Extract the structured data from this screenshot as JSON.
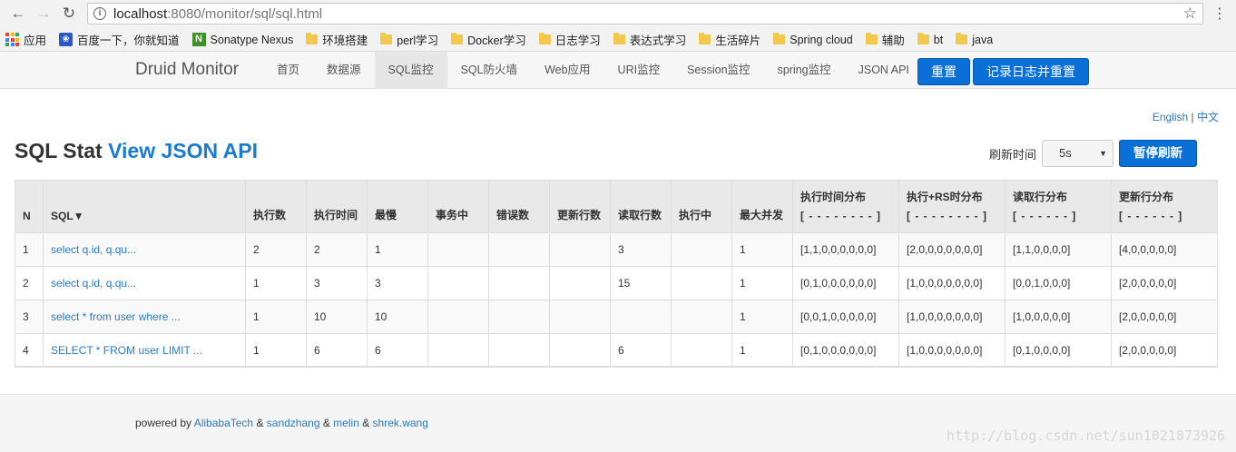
{
  "browser": {
    "url_host": "localhost",
    "url_rest": ":8080/monitor/sql/sql.html",
    "bookmarks": [
      {
        "label": "应用",
        "icon": "apps-grid-icon"
      },
      {
        "label": "百度一下，你就知道",
        "icon": "baidu-paw-icon"
      },
      {
        "label": "Sonatype Nexus",
        "icon": "nexus-icon"
      },
      {
        "label": "环境搭建",
        "icon": "folder-icon"
      },
      {
        "label": "perl学习",
        "icon": "folder-icon"
      },
      {
        "label": "Docker学习",
        "icon": "folder-icon"
      },
      {
        "label": "日志学习",
        "icon": "folder-icon"
      },
      {
        "label": "表达式学习",
        "icon": "folder-icon"
      },
      {
        "label": "生活碎片",
        "icon": "folder-icon"
      },
      {
        "label": "Spring cloud",
        "icon": "folder-icon"
      },
      {
        "label": "辅助",
        "icon": "folder-icon"
      },
      {
        "label": "bt",
        "icon": "folder-icon"
      },
      {
        "label": "java",
        "icon": "folder-icon"
      }
    ]
  },
  "nav": {
    "brand": "Druid Monitor",
    "links": [
      "首页",
      "数据源",
      "SQL监控",
      "SQL防火墙",
      "Web应用",
      "URI监控",
      "Session监控",
      "spring监控",
      "JSON API"
    ],
    "active_index": 2,
    "reset_label": "重置",
    "log_reset_label": "记录日志并重置"
  },
  "lang": {
    "english": "English",
    "sep": "|",
    "chinese": "中文"
  },
  "page": {
    "title_plain": "SQL Stat",
    "title_link": "View JSON API",
    "refresh_label": "刷新时间",
    "refresh_value": "5s",
    "pause_label": "暂停刷新"
  },
  "table": {
    "headers": [
      {
        "label": "N"
      },
      {
        "label": "SQL▼"
      },
      {
        "label": "执行数"
      },
      {
        "label": "执行时间"
      },
      {
        "label": "最慢"
      },
      {
        "label": "事务中"
      },
      {
        "label": "错误数"
      },
      {
        "label": "更新行数"
      },
      {
        "label": "读取行数"
      },
      {
        "label": "执行中"
      },
      {
        "label": "最大并发"
      },
      {
        "label": "执行时间分布",
        "sub": "[ - - - - - - - - ]"
      },
      {
        "label": "执行+RS时分布",
        "sub": "[ - - - - - - - - ]"
      },
      {
        "label": "读取行分布",
        "sub": "[ - - - - - - ]"
      },
      {
        "label": "更新行分布",
        "sub": "[ - - - - - - ]"
      }
    ],
    "rows": [
      [
        "1",
        "select q.id, q.qu...",
        "2",
        "2",
        "1",
        "",
        "",
        "",
        "3",
        "",
        "1",
        "[1,1,0,0,0,0,0,0]",
        "[2,0,0,0,0,0,0,0]",
        "[1,1,0,0,0,0]",
        "[4,0,0,0,0,0]"
      ],
      [
        "2",
        "select q.id, q.qu...",
        "1",
        "3",
        "3",
        "",
        "",
        "",
        "15",
        "",
        "1",
        "[0,1,0,0,0,0,0,0]",
        "[1,0,0,0,0,0,0,0]",
        "[0,0,1,0,0,0]",
        "[2,0,0,0,0,0]"
      ],
      [
        "3",
        "select * from user where ...",
        "1",
        "10",
        "10",
        "",
        "",
        "",
        "",
        "",
        "1",
        "[0,0,1,0,0,0,0,0]",
        "[1,0,0,0,0,0,0,0]",
        "[1,0,0,0,0,0]",
        "[2,0,0,0,0,0]"
      ],
      [
        "4",
        "SELECT * FROM user LIMIT ...",
        "1",
        "6",
        "6",
        "",
        "",
        "",
        "6",
        "",
        "1",
        "[0,1,0,0,0,0,0,0]",
        "[1,0,0,0,0,0,0,0]",
        "[0,1,0,0,0,0]",
        "[2,0,0,0,0,0]"
      ]
    ]
  },
  "footer": {
    "prefix": "powered by ",
    "authors": [
      "AlibabaTech",
      "sandzhang",
      "melin",
      "shrek.wang"
    ],
    "joiner": " & "
  },
  "watermark": "http://blog.csdn.net/sun1021873926",
  "colors": {
    "primary": "#0a6fd6",
    "link": "#2a7bc0"
  }
}
